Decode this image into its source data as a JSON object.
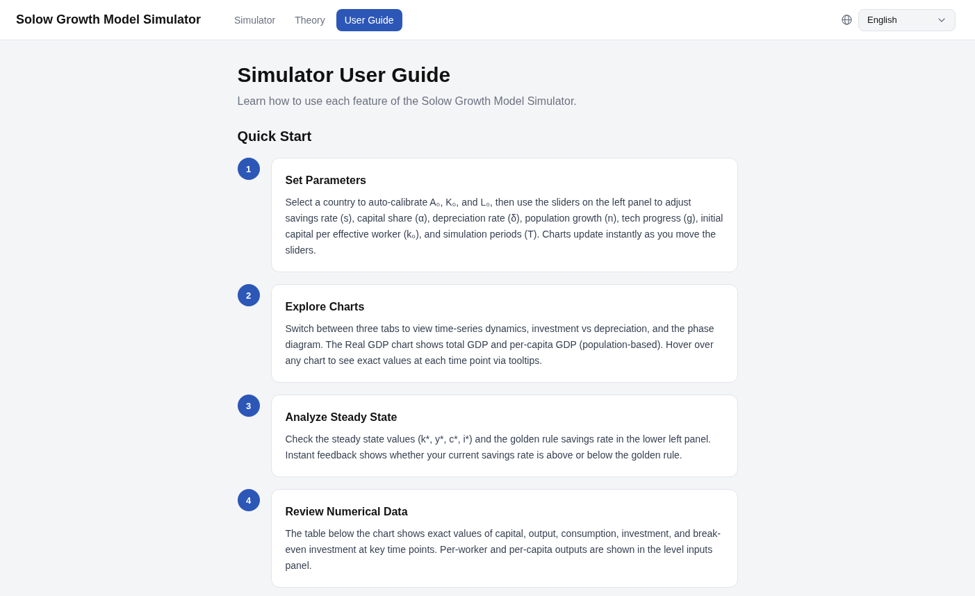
{
  "header": {
    "title": "Solow Growth Model Simulator",
    "nav": [
      {
        "label": "Simulator",
        "selected": false
      },
      {
        "label": "Theory",
        "selected": false
      },
      {
        "label": "User Guide",
        "selected": true
      }
    ],
    "language_select": {
      "value": "English"
    }
  },
  "page": {
    "title": "Simulator User Guide",
    "subtitle": "Learn how to use each feature of the Solow Growth Model Simulator.",
    "section_title": "Quick Start",
    "steps": [
      {
        "number": "1",
        "title": "Set Parameters",
        "text": "Select a country to auto-calibrate A₀, K₀, and L₀, then use the sliders on the left panel to adjust savings rate (s), capital share (α), depreciation rate (δ), population growth (n), tech progress (g), initial capital per effective worker (k₀), and simulation periods (T). Charts update instantly as you move the sliders."
      },
      {
        "number": "2",
        "title": "Explore Charts",
        "text": "Switch between three tabs to view time-series dynamics, investment vs depreciation, and the phase diagram. The Real GDP chart shows total GDP and per-capita GDP (population-based). Hover over any chart to see exact values at each time point via tooltips."
      },
      {
        "number": "3",
        "title": "Analyze Steady State",
        "text": "Check the steady state values (k*, y*, c*, i*) and the golden rule savings rate in the lower left panel. Instant feedback shows whether your current savings rate is above or below the golden rule."
      },
      {
        "number": "4",
        "title": "Review Numerical Data",
        "text": "The table below the chart shows exact values of capital, output, consumption, investment, and break-even investment at key time points. Per-worker and per-capita outputs are shown in the level inputs panel."
      }
    ]
  }
}
